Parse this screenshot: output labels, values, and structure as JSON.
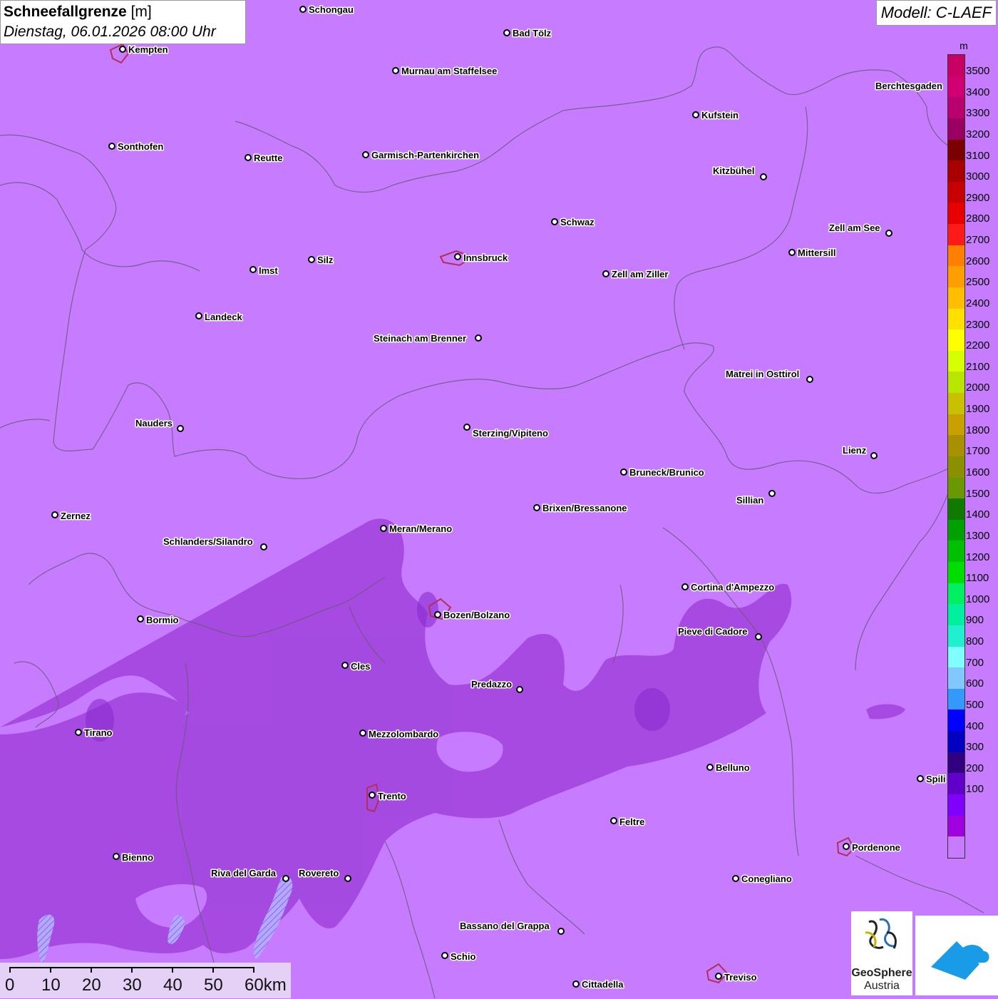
{
  "header": {
    "title_bold": "Schneefallgrenze",
    "title_unit": "[m]",
    "datetime": "Dienstag, 06.01.2026 08:00 Uhr",
    "model_label": "Modell: C-LAEF"
  },
  "legend": {
    "unit": "m",
    "colors": [
      "#c90064",
      "#d00072",
      "#b8006f",
      "#9a0061",
      "#7b0000",
      "#a80000",
      "#c90000",
      "#e80000",
      "#ff1a1a",
      "#ff8000",
      "#ff9e00",
      "#ffbf00",
      "#ffe000",
      "#ffff00",
      "#d6ff00",
      "#b8e600",
      "#c8c000",
      "#c8a000",
      "#a89000",
      "#8a9000",
      "#6a9800",
      "#107a00",
      "#00a000",
      "#00c000",
      "#00dd00",
      "#00f060",
      "#00f0a0",
      "#20f0d0",
      "#80ffff",
      "#80c8ff",
      "#3399ff",
      "#0000ff",
      "#0000c0",
      "#300080",
      "#6000c8",
      "#8000ff",
      "#a000e0",
      "#c77cff"
    ],
    "labels": [
      "3500",
      "3400",
      "3300",
      "3200",
      "3100",
      "3000",
      "2900",
      "2800",
      "2700",
      "2600",
      "2500",
      "2400",
      "2300",
      "2200",
      "2100",
      "2000",
      "1900",
      "1800",
      "1700",
      "1600",
      "1500",
      "1400",
      "1300",
      "1200",
      "1100",
      "1000",
      "900",
      "800",
      "700",
      "600",
      "500",
      "400",
      "300",
      "200",
      "100"
    ]
  },
  "scale_bar": {
    "labels": [
      "0",
      "10",
      "20",
      "30",
      "40",
      "50",
      "60km"
    ]
  },
  "colors": {
    "background_snowline": "#c77cff",
    "low_snowline": "#9a3ad6",
    "border_lines": "#666666"
  },
  "logo": {
    "line1": "GeoSphere",
    "line2": "Austria"
  },
  "cities": [
    {
      "name": "Schongau"
    },
    {
      "name": "Bad Tölz"
    },
    {
      "name": "Kempten"
    },
    {
      "name": "Murnau am Staffelsee"
    },
    {
      "name": "Berchtesgaden"
    },
    {
      "name": "Kufstein"
    },
    {
      "name": "Sonthofen"
    },
    {
      "name": "Reutte"
    },
    {
      "name": "Garmisch-Partenkirchen"
    },
    {
      "name": "Kitzbühel"
    },
    {
      "name": "Schwaz"
    },
    {
      "name": "Zell am See"
    },
    {
      "name": "Innsbruck"
    },
    {
      "name": "Mittersill"
    },
    {
      "name": "Imst"
    },
    {
      "name": "Silz"
    },
    {
      "name": "Zell am Ziller"
    },
    {
      "name": "Landeck"
    },
    {
      "name": "Steinach am Brenner"
    },
    {
      "name": "Matrei in Osttirol"
    },
    {
      "name": "Nauders"
    },
    {
      "name": "Sterzing/Vipiteno"
    },
    {
      "name": "Lienz"
    },
    {
      "name": "Bruneck/Brunico"
    },
    {
      "name": "Sillian"
    },
    {
      "name": "Zernez"
    },
    {
      "name": "Brixen/Bressanone"
    },
    {
      "name": "Meran/Merano"
    },
    {
      "name": "Schlanders/Silandro"
    },
    {
      "name": "Cortina d'Ampezzo"
    },
    {
      "name": "Bormio"
    },
    {
      "name": "Bozen/Bolzano"
    },
    {
      "name": "Pieve di Cadore"
    },
    {
      "name": "Cles"
    },
    {
      "name": "Predazzo"
    },
    {
      "name": "Tirano"
    },
    {
      "name": "Mezzolombardo"
    },
    {
      "name": "Belluno"
    },
    {
      "name": "Spili"
    },
    {
      "name": "Trento"
    },
    {
      "name": "Feltre"
    },
    {
      "name": "Pordenone"
    },
    {
      "name": "Bienno"
    },
    {
      "name": "Riva del Garda"
    },
    {
      "name": "Rovereto"
    },
    {
      "name": "Conegliano"
    },
    {
      "name": "Bassano del Grappa"
    },
    {
      "name": "Schio"
    },
    {
      "name": "Treviso"
    },
    {
      "name": "Cittadella"
    }
  ]
}
